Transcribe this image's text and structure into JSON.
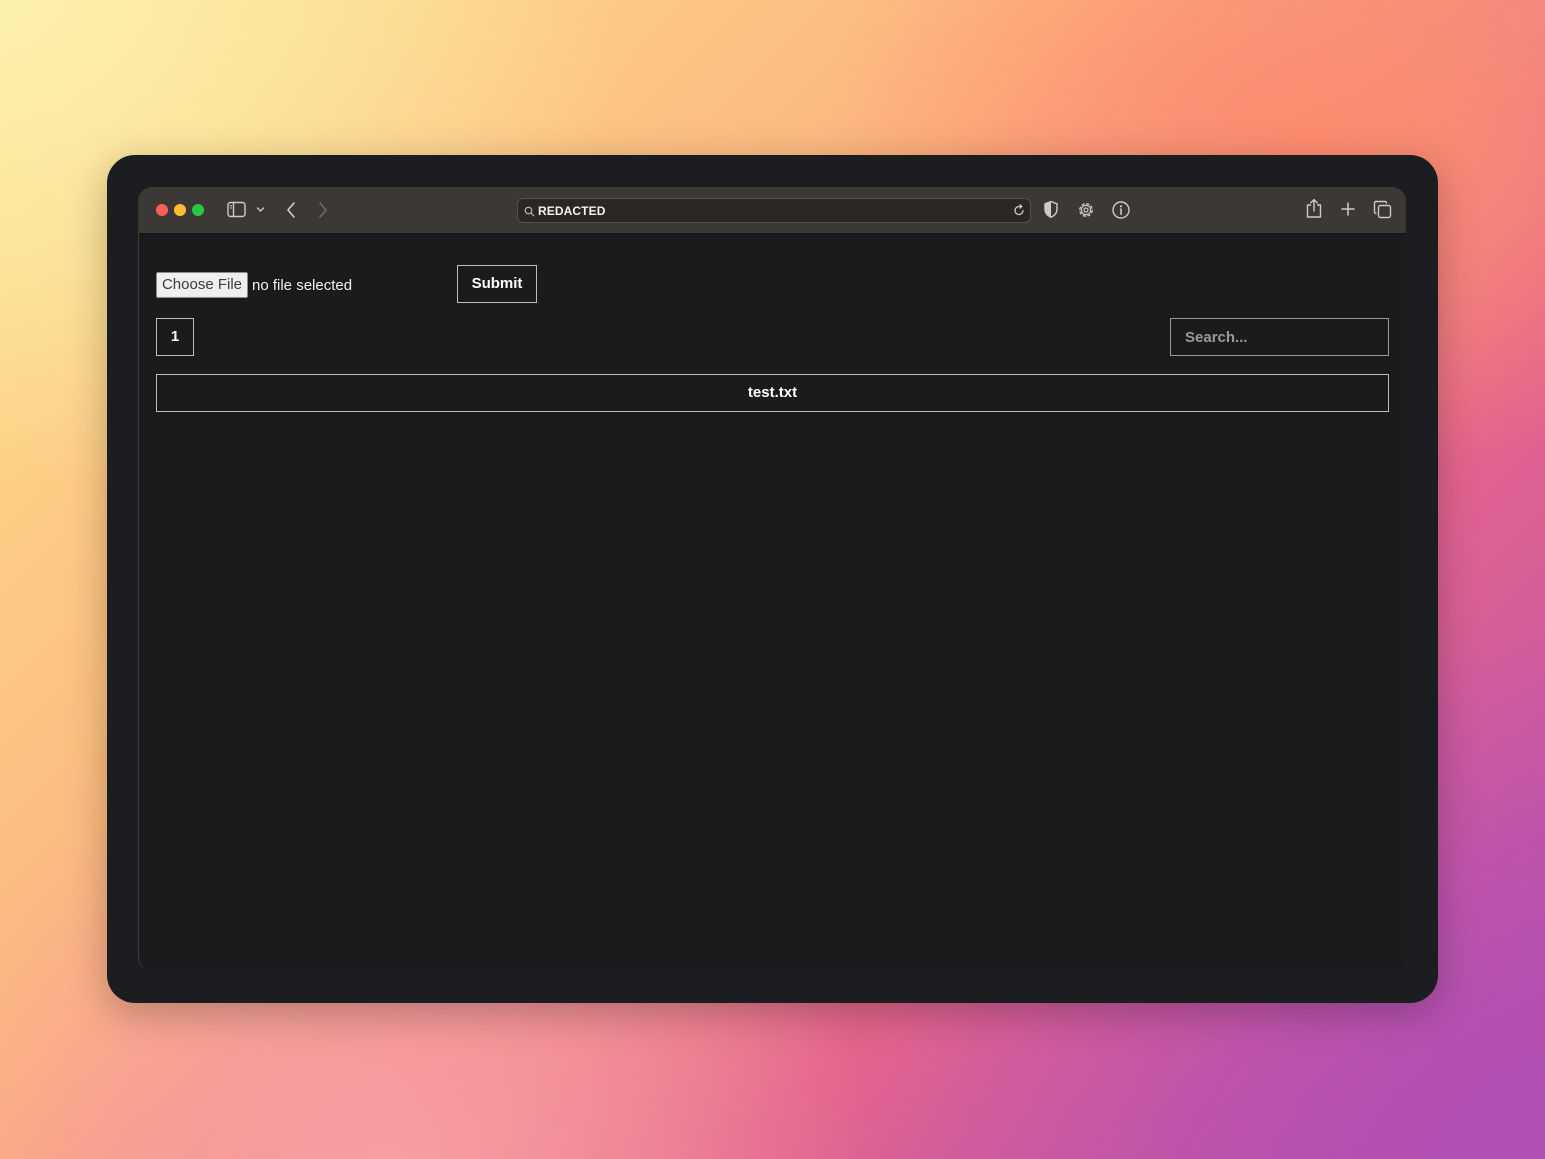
{
  "browser": {
    "address": "REDACTED"
  },
  "upload": {
    "choose_file_label": "Choose File",
    "file_status": "no file selected",
    "submit_label": "Submit"
  },
  "pagination": {
    "current_page": "1"
  },
  "search": {
    "placeholder": "Search..."
  },
  "files": [
    {
      "name": "test.txt"
    }
  ],
  "colors": {
    "page_background": "#1b1b1d",
    "toolbar": "#3b3836",
    "traffic_red": "#fe5f57",
    "traffic_yellow": "#febc2e",
    "traffic_green": "#28c840"
  }
}
